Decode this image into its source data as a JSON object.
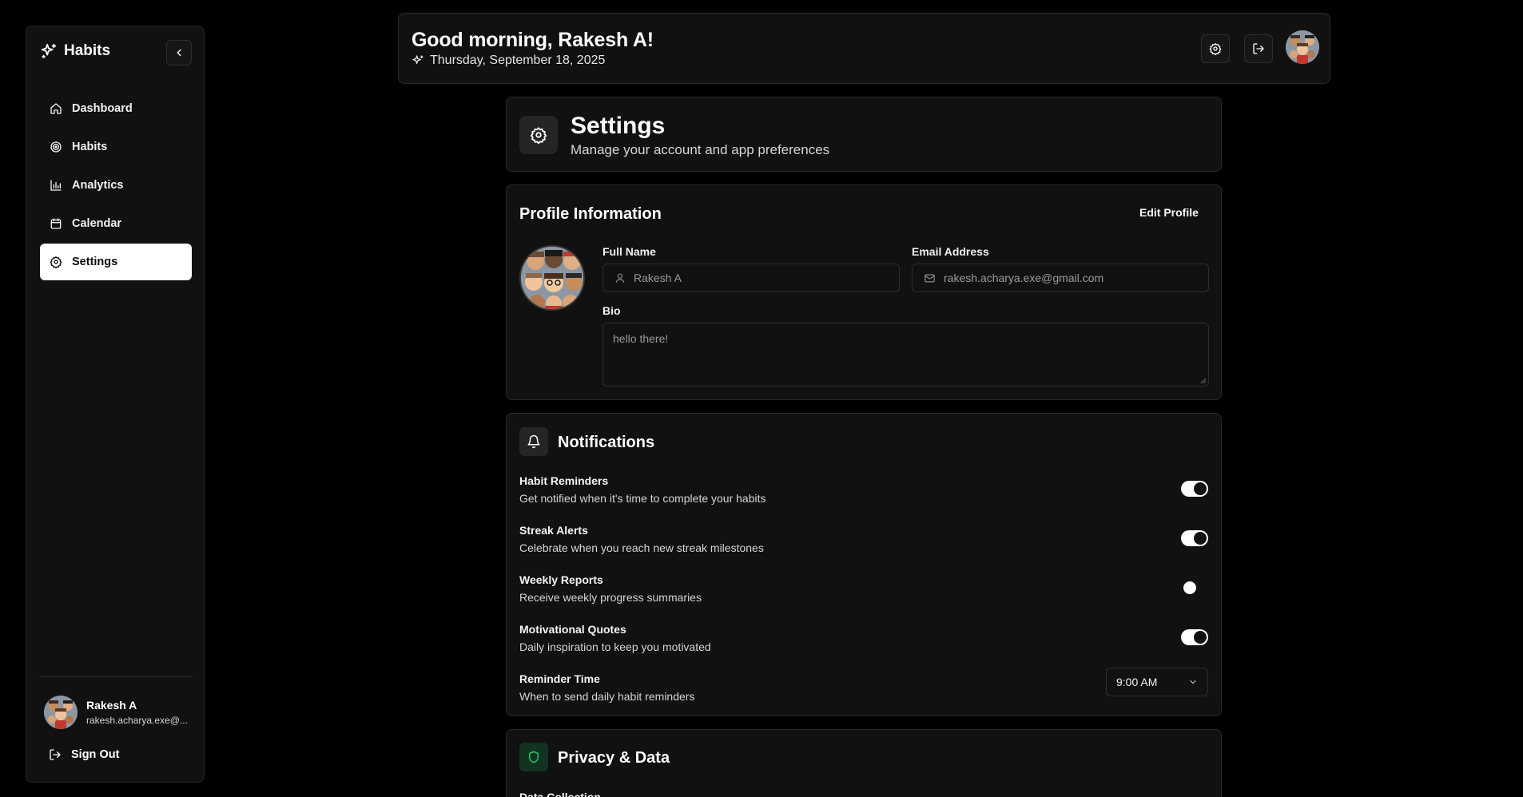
{
  "brand": {
    "name": "Habits",
    "icon": "sparkles-icon"
  },
  "sidebar": {
    "items": [
      {
        "label": "Dashboard",
        "icon": "home-icon",
        "active": false
      },
      {
        "label": "Habits",
        "icon": "target-icon",
        "active": false
      },
      {
        "label": "Analytics",
        "icon": "bar-chart-icon",
        "active": false
      },
      {
        "label": "Calendar",
        "icon": "calendar-icon",
        "active": false
      },
      {
        "label": "Settings",
        "icon": "gear-icon",
        "active": true
      }
    ],
    "user": {
      "name": "Rakesh A",
      "email": "rakesh.acharya.exe@..."
    },
    "sign_out_label": "Sign Out"
  },
  "header": {
    "greeting": "Good morning, Rakesh A!",
    "date": "Thursday, September 18, 2025"
  },
  "page": {
    "title": "Settings",
    "subtitle": "Manage your account and app preferences"
  },
  "profile": {
    "title": "Profile Information",
    "edit_label": "Edit Profile",
    "full_name_label": "Full Name",
    "full_name_value": "Rakesh A",
    "email_label": "Email Address",
    "email_value": "rakesh.acharya.exe@gmail.com",
    "bio_label": "Bio",
    "bio_value": "hello there!"
  },
  "notifications": {
    "title": "Notifications",
    "items": [
      {
        "title": "Habit Reminders",
        "desc": "Get notified when it's time to complete your habits",
        "enabled": true
      },
      {
        "title": "Streak Alerts",
        "desc": "Celebrate when you reach new streak milestones",
        "enabled": true
      },
      {
        "title": "Weekly Reports",
        "desc": "Receive weekly progress summaries",
        "enabled": false
      },
      {
        "title": "Motivational Quotes",
        "desc": "Daily inspiration to keep you motivated",
        "enabled": true
      }
    ],
    "reminder": {
      "title": "Reminder Time",
      "desc": "When to send daily habit reminders",
      "value": "9:00 AM"
    }
  },
  "privacy": {
    "title": "Privacy & Data",
    "first_item": "Data Collection",
    "accent_color": "#22c55e"
  },
  "colors": {
    "background": "#000000",
    "card": "#111111",
    "border": "#2a2a2a",
    "active_nav_bg": "#ffffff"
  }
}
